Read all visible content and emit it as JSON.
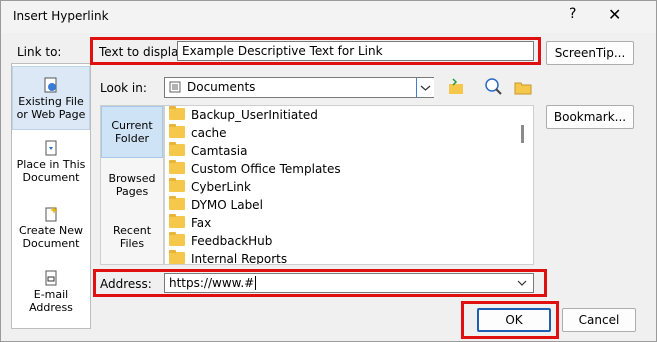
{
  "window": {
    "title": "Insert Hyperlink",
    "help": "?",
    "close": "✕"
  },
  "link_to": {
    "label": "Link to:",
    "items": [
      {
        "label_1": "Existing File",
        "label_2": "or Web Page",
        "icon": "web-page-icon"
      },
      {
        "label_1": "Place in This",
        "label_2": "Document",
        "icon": "document-place-icon"
      },
      {
        "label_1": "Create New",
        "label_2": "Document",
        "icon": "new-document-icon"
      },
      {
        "label_1": "E-mail",
        "label_2": "Address",
        "icon": "email-icon"
      }
    ]
  },
  "text_to_display": {
    "label": "Text to display:",
    "value": "Example Descriptive Text for Link"
  },
  "screentip_button": "ScreenTip...",
  "look_in": {
    "label": "Look in:",
    "value": "Documents"
  },
  "bookmark_button": "Bookmark...",
  "nav": [
    {
      "label_1": "Current",
      "label_2": "Folder"
    },
    {
      "label_1": "Browsed",
      "label_2": "Pages"
    },
    {
      "label_1": "Recent",
      "label_2": "Files"
    }
  ],
  "files": [
    "Backup_UserInitiated",
    "cache",
    "Camtasia",
    "Custom Office Templates",
    "CyberLink",
    "DYMO Label",
    "Fax",
    "FeedbackHub",
    "Internal Reports"
  ],
  "address": {
    "label": "Address:",
    "value": "https://www.#"
  },
  "ok_button": "OK",
  "cancel_button": "Cancel",
  "colors": {
    "highlight": "#e01010",
    "active_bg": "#dce8f5"
  }
}
